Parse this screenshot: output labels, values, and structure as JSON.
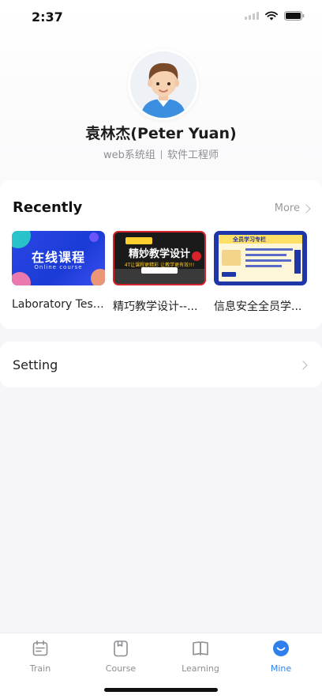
{
  "status_bar": {
    "time": "2:37"
  },
  "profile": {
    "name": "袁林杰(Peter Yuan)",
    "department": "web系统组",
    "position": "软件工程师"
  },
  "recently": {
    "title": "Recently",
    "more_label": "More",
    "courses": [
      {
        "title": "Laboratory Testi...",
        "thumb_text": "在线课程",
        "thumb_subtext": "Online course"
      },
      {
        "title": "精巧教学设计--...",
        "thumb_text": "精妙教学设计",
        "thumb_subtext": "4T让课程更精彩 让教学更有效!!!"
      },
      {
        "title": "信息安全全员学...",
        "thumb_text": "全员学习专栏",
        "thumb_subtext": ""
      }
    ]
  },
  "setting": {
    "label": "Setting"
  },
  "tabbar": {
    "items": [
      {
        "label": "Train",
        "icon": "calendar-icon"
      },
      {
        "label": "Course",
        "icon": "course-icon"
      },
      {
        "label": "Learning",
        "icon": "book-icon"
      },
      {
        "label": "Mine",
        "icon": "mine-icon"
      }
    ],
    "active": "Mine",
    "accent_color": "#2f80ed"
  }
}
